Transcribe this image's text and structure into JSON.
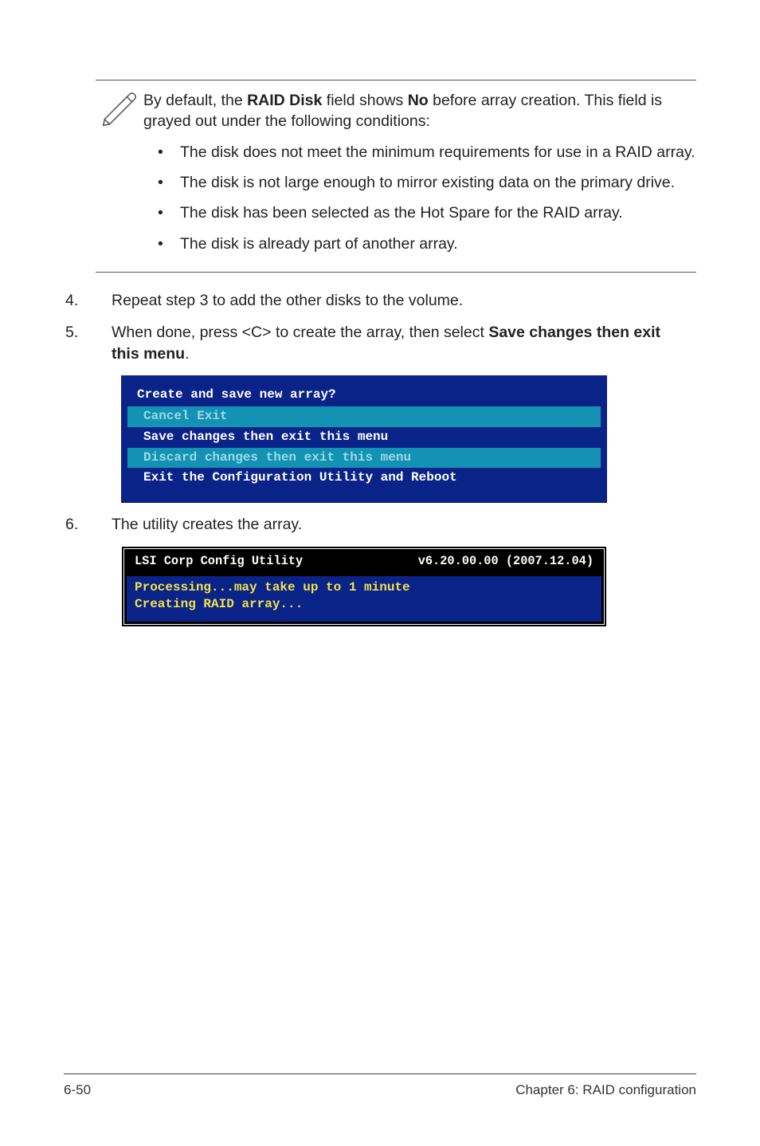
{
  "note": {
    "intro_pre": "By default, the ",
    "intro_bold1": "RAID Disk",
    "intro_mid": " field shows ",
    "intro_bold2": "No",
    "intro_post": " before array creation. This field is grayed out under the following conditions:",
    "bullets": [
      "The disk does not meet the minimum requirements for use in a RAID array.",
      "The disk is not large enough to mirror existing data on the primary drive.",
      "The disk has been selected as the Hot Spare for the RAID array.",
      "The disk is already part of another array."
    ]
  },
  "steps": {
    "s4": {
      "num": "4.",
      "text": "Repeat step 3 to add the other disks to the volume."
    },
    "s5": {
      "num": "5.",
      "pre": "When done, press <C> to create the array, then select ",
      "bold": "Save changes then exit this menu",
      "post": "."
    },
    "s6": {
      "num": "6.",
      "text": "The utility creates the array."
    }
  },
  "dialog": {
    "title": "Create and save new array?",
    "rows": [
      {
        "label": "Cancel Exit",
        "enabled": false
      },
      {
        "label": "Save changes then exit this menu",
        "enabled": true
      },
      {
        "label": "Discard changes then exit this menu",
        "enabled": false
      },
      {
        "label": "Exit the Configuration Utility and Reboot",
        "enabled": true
      }
    ]
  },
  "proc": {
    "header_left": "LSI Corp Config Utility",
    "header_right": "v6.20.00.00 (2007.12.04)",
    "line1": "Processing...may take up to 1 minute",
    "line2": "Creating RAID array..."
  },
  "footer": {
    "page": "6-50",
    "chapter": "Chapter 6: RAID configuration"
  }
}
